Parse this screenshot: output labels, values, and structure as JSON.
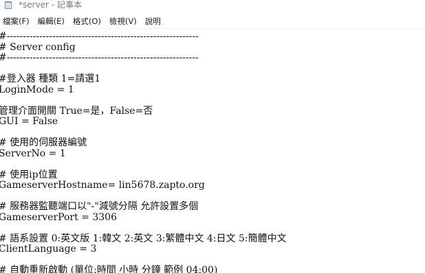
{
  "window": {
    "title": "*server - 記事本"
  },
  "menu": {
    "items": [
      {
        "name": "menu-file",
        "label": "檔案(F)"
      },
      {
        "name": "menu-edit",
        "label": "編輯(E)"
      },
      {
        "name": "menu-format",
        "label": "格式(O)"
      },
      {
        "name": "menu-view",
        "label": "檢視(V)"
      },
      {
        "name": "menu-help",
        "label": "說明"
      }
    ]
  },
  "editor": {
    "lines": [
      "#-----------------------------------------------------------",
      "# Server config",
      "#-----------------------------------------------------------",
      "",
      "#登入器 種類 1=請選1",
      "LoginMode = 1",
      "",
      "管理介面開關 True=是，False=否",
      "GUI = False",
      "",
      "# 使用的伺服器編號",
      "ServerNo = 1",
      "",
      "# 使用ip位置",
      "GameserverHostname= lin5678.zapto.org",
      "",
      "# 服務器監聽端口以\"-\"減號分隔 允許設置多個",
      "GameserverPort = 3306",
      "",
      "# 語系設置 0:英文版 1:韓文 2:英文 3:繁體中文 4:日文 5:簡體中文",
      "ClientLanguage = 3",
      "",
      "# 自動重新啟動 (單位:時間 小時 分鐘 範例 04:00)"
    ]
  }
}
